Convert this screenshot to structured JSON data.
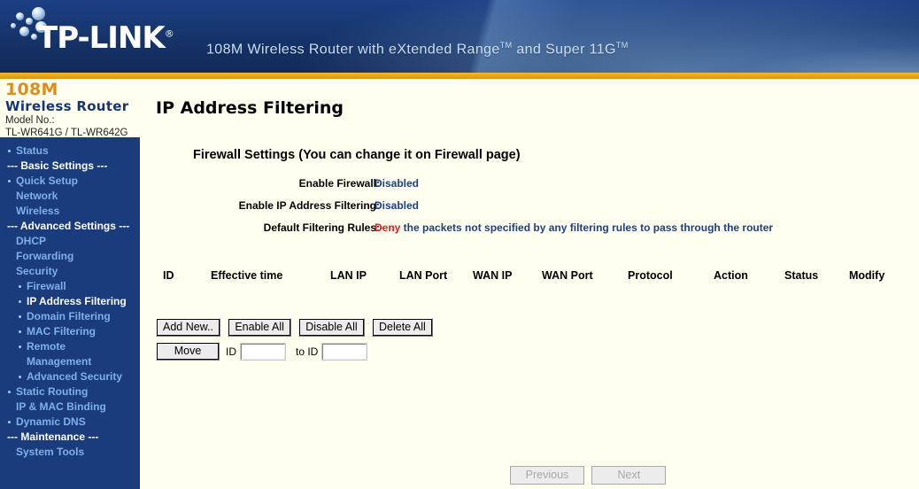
{
  "banner": {
    "brand": "TP-LINK",
    "brand_reg": "®",
    "tagline_part1": "108M Wireless Router with eXtended Range",
    "tagline_tm1": "TM",
    "tagline_part2": " and Super 11G",
    "tagline_tm2": "TM"
  },
  "sidebar": {
    "model_108m": "108M",
    "model_wireless_router": "Wireless  Router",
    "model_no_label": "Model No.:",
    "model_no_value": "TL-WR641G / TL-WR642G",
    "items": [
      {
        "label": "Status",
        "level": 1,
        "bullet": true,
        "active": false,
        "type": "link"
      },
      {
        "label": "--- Basic Settings ---",
        "level": 0,
        "bullet": false,
        "active": false,
        "type": "section"
      },
      {
        "label": "Quick Setup",
        "level": 1,
        "bullet": true,
        "active": false,
        "type": "link"
      },
      {
        "label": "Network",
        "level": 1,
        "bullet": false,
        "active": false,
        "type": "link"
      },
      {
        "label": "Wireless",
        "level": 1,
        "bullet": false,
        "active": false,
        "type": "link"
      },
      {
        "label": "--- Advanced Settings ---",
        "level": 0,
        "bullet": false,
        "active": false,
        "type": "section"
      },
      {
        "label": "DHCP",
        "level": 1,
        "bullet": false,
        "active": false,
        "type": "link"
      },
      {
        "label": "Forwarding",
        "level": 1,
        "bullet": false,
        "active": false,
        "type": "link"
      },
      {
        "label": "Security",
        "level": 1,
        "bullet": false,
        "active": false,
        "type": "link"
      },
      {
        "label": "Firewall",
        "level": 2,
        "bullet": true,
        "active": false,
        "type": "link"
      },
      {
        "label": "IP Address Filtering",
        "level": 2,
        "bullet": true,
        "active": true,
        "type": "link"
      },
      {
        "label": "Domain Filtering",
        "level": 2,
        "bullet": true,
        "active": false,
        "type": "link"
      },
      {
        "label": "MAC Filtering",
        "level": 2,
        "bullet": true,
        "active": false,
        "type": "link"
      },
      {
        "label": "Remote",
        "level": 2,
        "bullet": true,
        "active": false,
        "type": "link"
      },
      {
        "label": "Management",
        "level": 2,
        "bullet": false,
        "active": false,
        "type": "link"
      },
      {
        "label": "Advanced Security",
        "level": 2,
        "bullet": true,
        "active": false,
        "type": "link"
      },
      {
        "label": "Static Routing",
        "level": 1,
        "bullet": true,
        "active": false,
        "type": "link"
      },
      {
        "label": "IP & MAC Binding",
        "level": 1,
        "bullet": false,
        "active": false,
        "type": "link"
      },
      {
        "label": "Dynamic DNS",
        "level": 1,
        "bullet": true,
        "active": false,
        "type": "link"
      },
      {
        "label": "--- Maintenance ---",
        "level": 0,
        "bullet": false,
        "active": false,
        "type": "section"
      },
      {
        "label": "System Tools",
        "level": 1,
        "bullet": false,
        "active": false,
        "type": "link"
      }
    ]
  },
  "main": {
    "page_title": "IP Address Filtering",
    "firewall_heading": "Firewall Settings (You can change it on Firewall page)",
    "settings": [
      {
        "label": "Enable Firewall:",
        "value": "Disabled"
      },
      {
        "label": "Enable IP Address Filtering:",
        "value": "Disabled"
      }
    ],
    "default_rule": {
      "label": "Default Filtering Rules:",
      "action": "Deny",
      "text": " the packets not specified by any filtering rules to pass through the router"
    },
    "table": {
      "columns": [
        "ID",
        "Effective time",
        "LAN IP",
        "LAN Port",
        "WAN IP",
        "WAN Port",
        "Protocol",
        "Action",
        "Status",
        "Modify"
      ],
      "rows": []
    },
    "buttons": {
      "add_new": "Add New..",
      "enable_all": "Enable All",
      "disable_all": "Disable All",
      "delete_all": "Delete All",
      "move": "Move",
      "previous": "Previous",
      "next": "Next"
    },
    "move_controls": {
      "id_label": "ID",
      "id_value": "",
      "to_id_label": "to ID",
      "to_id_value": ""
    }
  },
  "colors": {
    "banner_blue": "#17366f",
    "gold_stripe": "#e5a516",
    "sidebar_blue": "#1b3c7c",
    "link_blue": "#7fb0e8",
    "page_bg": "#fffff0",
    "value_blue": "#1c3f84",
    "deny_red": "#e01b1b",
    "brand_orange": "#e08b1a"
  }
}
